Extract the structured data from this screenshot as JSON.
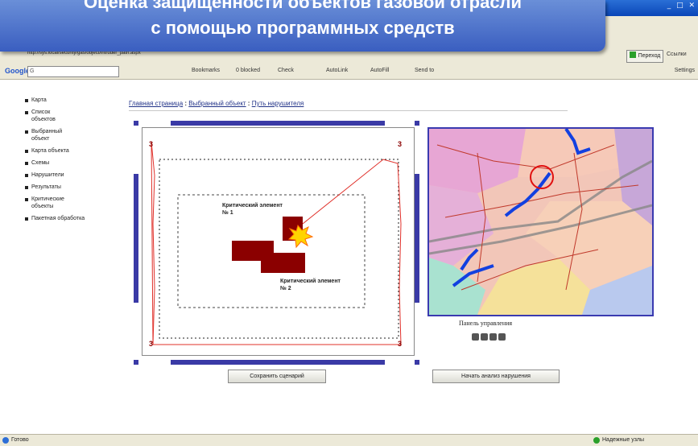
{
  "browser": {
    "address_url": "http://sys.local/security/gas/object/intruder_path.aspx",
    "go_label": "Переход",
    "links_label": "Ссылки",
    "google_logo": "Google",
    "google_search_value": "G",
    "toolbar_items": [
      "Bookmarks",
      "0 blocked",
      "Check",
      "AutoLink",
      "AutoFill",
      "Send to"
    ],
    "settings_label": "Settings"
  },
  "slide_title": {
    "line1": "Оценка защищенности объектов газовой отрасли",
    "line2": "с помощью программных средств"
  },
  "nav": {
    "items": [
      "Карта",
      "Список объектов",
      "Выбранный объект",
      "Карта объекта",
      "Схемы",
      "Нарушители",
      "Результаты",
      "Критические объекты",
      "Пакетная обработка"
    ]
  },
  "breadcrumb": {
    "home": "Главная страница",
    "selected": "Выбранный объект",
    "current": "Путь нарушителя",
    "separator": " : "
  },
  "plan": {
    "critical_1": "Критический элемент № 1",
    "critical_2": "Критический элемент № 2",
    "corner_label": "3"
  },
  "panel": {
    "title": "Панель управления"
  },
  "buttons": {
    "save": "Сохранить сценарий",
    "start": "Начать анализ нарушения"
  },
  "status": {
    "left": "Готово",
    "right": "Надежные узлы"
  },
  "colors": {
    "accent": "#3a3aa6",
    "critical": "#8b0000",
    "path": "#e0302a"
  }
}
